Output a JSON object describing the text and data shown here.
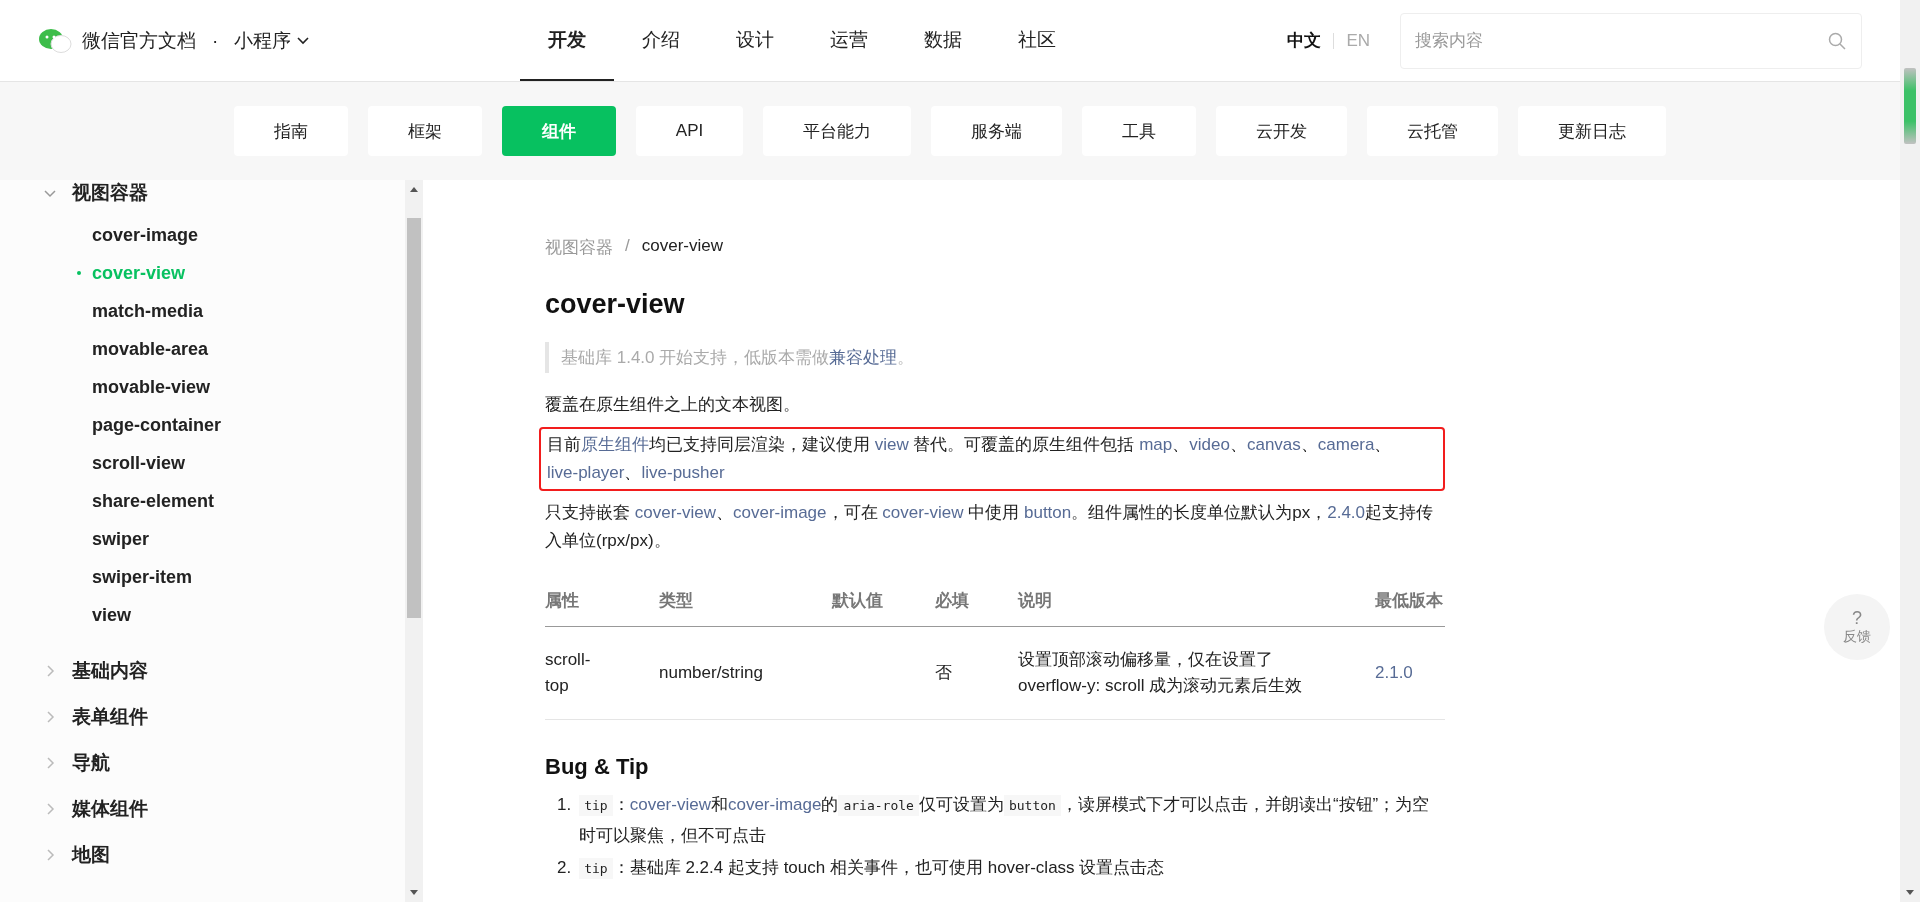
{
  "header": {
    "site_title": "微信官方文档",
    "separator": "·",
    "product": "小程序",
    "nav": [
      {
        "label": "开发",
        "selected": true
      },
      {
        "label": "介绍",
        "selected": false
      },
      {
        "label": "设计",
        "selected": false
      },
      {
        "label": "运营",
        "selected": false
      },
      {
        "label": "数据",
        "selected": false
      },
      {
        "label": "社区",
        "selected": false
      }
    ],
    "languages": [
      {
        "label": "中文",
        "selected": true
      },
      {
        "label": "EN",
        "selected": false
      }
    ],
    "search": {
      "placeholder": "搜索内容"
    }
  },
  "subnav": [
    {
      "label": "指南",
      "selected": false
    },
    {
      "label": "框架",
      "selected": false
    },
    {
      "label": "组件",
      "selected": true
    },
    {
      "label": "API",
      "selected": false
    },
    {
      "label": "平台能力",
      "selected": false
    },
    {
      "label": "服务端",
      "selected": false
    },
    {
      "label": "工具",
      "selected": false
    },
    {
      "label": "云开发",
      "selected": false
    },
    {
      "label": "云托管",
      "selected": false
    },
    {
      "label": "更新日志",
      "selected": false
    }
  ],
  "sidebar": {
    "groups": [
      {
        "label": "视图容器",
        "expanded": true,
        "children": [
          {
            "label": "cover-image",
            "selected": false
          },
          {
            "label": "cover-view",
            "selected": true
          },
          {
            "label": "match-media",
            "selected": false
          },
          {
            "label": "movable-area",
            "selected": false
          },
          {
            "label": "movable-view",
            "selected": false
          },
          {
            "label": "page-container",
            "selected": false
          },
          {
            "label": "scroll-view",
            "selected": false
          },
          {
            "label": "share-element",
            "selected": false
          },
          {
            "label": "swiper",
            "selected": false
          },
          {
            "label": "swiper-item",
            "selected": false
          },
          {
            "label": "view",
            "selected": false
          }
        ]
      },
      {
        "label": "基础内容",
        "expanded": false
      },
      {
        "label": "表单组件",
        "expanded": false
      },
      {
        "label": "导航",
        "expanded": false
      },
      {
        "label": "媒体组件",
        "expanded": false
      },
      {
        "label": "地图",
        "expanded": false
      }
    ]
  },
  "content": {
    "breadcrumb": [
      "视图容器",
      "cover-view"
    ],
    "breadcrumb_separator": "/",
    "title": "cover-view",
    "note": [
      {
        "kind": "text",
        "text": "基础库 1.4.0 开始支持，低版本需做"
      },
      {
        "kind": "link",
        "text": "兼容处理"
      },
      {
        "kind": "text",
        "text": "。"
      }
    ],
    "paragraphs": [
      {
        "highlighted": false,
        "segments": [
          {
            "kind": "text",
            "text": "覆盖在原生组件之上的文本视图。"
          }
        ]
      },
      {
        "highlighted": true,
        "segments": [
          {
            "kind": "text",
            "text": "目前"
          },
          {
            "kind": "link",
            "text": "原生组件"
          },
          {
            "kind": "text",
            "text": "均已支持同层渲染，建议使用 "
          },
          {
            "kind": "link",
            "text": "view"
          },
          {
            "kind": "text",
            "text": " 替代。可覆盖的原生组件包括 "
          },
          {
            "kind": "link",
            "text": "map"
          },
          {
            "kind": "text",
            "text": "、"
          },
          {
            "kind": "link",
            "text": "video"
          },
          {
            "kind": "text",
            "text": "、"
          },
          {
            "kind": "link",
            "text": "canvas"
          },
          {
            "kind": "text",
            "text": "、"
          },
          {
            "kind": "link",
            "text": "camera"
          },
          {
            "kind": "text",
            "text": "、"
          },
          {
            "kind": "link",
            "text": "live-player"
          },
          {
            "kind": "text",
            "text": "、"
          },
          {
            "kind": "link",
            "text": "live-pusher"
          }
        ]
      },
      {
        "highlighted": false,
        "segments": [
          {
            "kind": "text",
            "text": "只支持嵌套 "
          },
          {
            "kind": "link",
            "text": "cover-view"
          },
          {
            "kind": "text",
            "text": "、"
          },
          {
            "kind": "link",
            "text": "cover-image"
          },
          {
            "kind": "text",
            "text": "，可在 "
          },
          {
            "kind": "link",
            "text": "cover-view"
          },
          {
            "kind": "text",
            "text": " 中使用 "
          },
          {
            "kind": "link",
            "text": "button"
          },
          {
            "kind": "text",
            "text": "。组件属性的长度单位默认为px，"
          },
          {
            "kind": "link",
            "text": "2.4.0"
          },
          {
            "kind": "text",
            "text": "起支持传入单位(rpx/px)。"
          }
        ]
      }
    ],
    "table": {
      "columns": [
        "属性",
        "类型",
        "默认值",
        "必填",
        "说明",
        "最低版本"
      ],
      "rows": [
        {
          "property": "scroll-top",
          "type": "number/string",
          "required": "否",
          "description": "设置顶部滚动偏移量，仅在设置了 overflow-y: scroll 成为滚动元素后生效",
          "min_version": "2.1.0"
        }
      ]
    },
    "section_title": "Bug & Tip",
    "tips": [
      {
        "number": "1.",
        "segments": [
          {
            "kind": "code",
            "text": "tip"
          },
          {
            "kind": "text",
            "text": "："
          },
          {
            "kind": "link",
            "text": "cover-view"
          },
          {
            "kind": "text",
            "text": "和"
          },
          {
            "kind": "link",
            "text": "cover-image"
          },
          {
            "kind": "text",
            "text": "的"
          },
          {
            "kind": "code",
            "text": "aria-role"
          },
          {
            "kind": "text",
            "text": "仅可设置为"
          },
          {
            "kind": "code",
            "text": "button"
          },
          {
            "kind": "text",
            "text": "，读屏模式下才可以点击，并朗读出“按钮”；为空时可以聚焦，但不可点击"
          }
        ]
      },
      {
        "number": "2.",
        "segments": [
          {
            "kind": "code",
            "text": "tip"
          },
          {
            "kind": "text",
            "text": "：基础库 2.2.4 起支持 touch 相关事件，也可使用 hover-class 设置点击态"
          }
        ]
      }
    ]
  },
  "feedback": {
    "icon_text": "?",
    "label": "反馈"
  }
}
